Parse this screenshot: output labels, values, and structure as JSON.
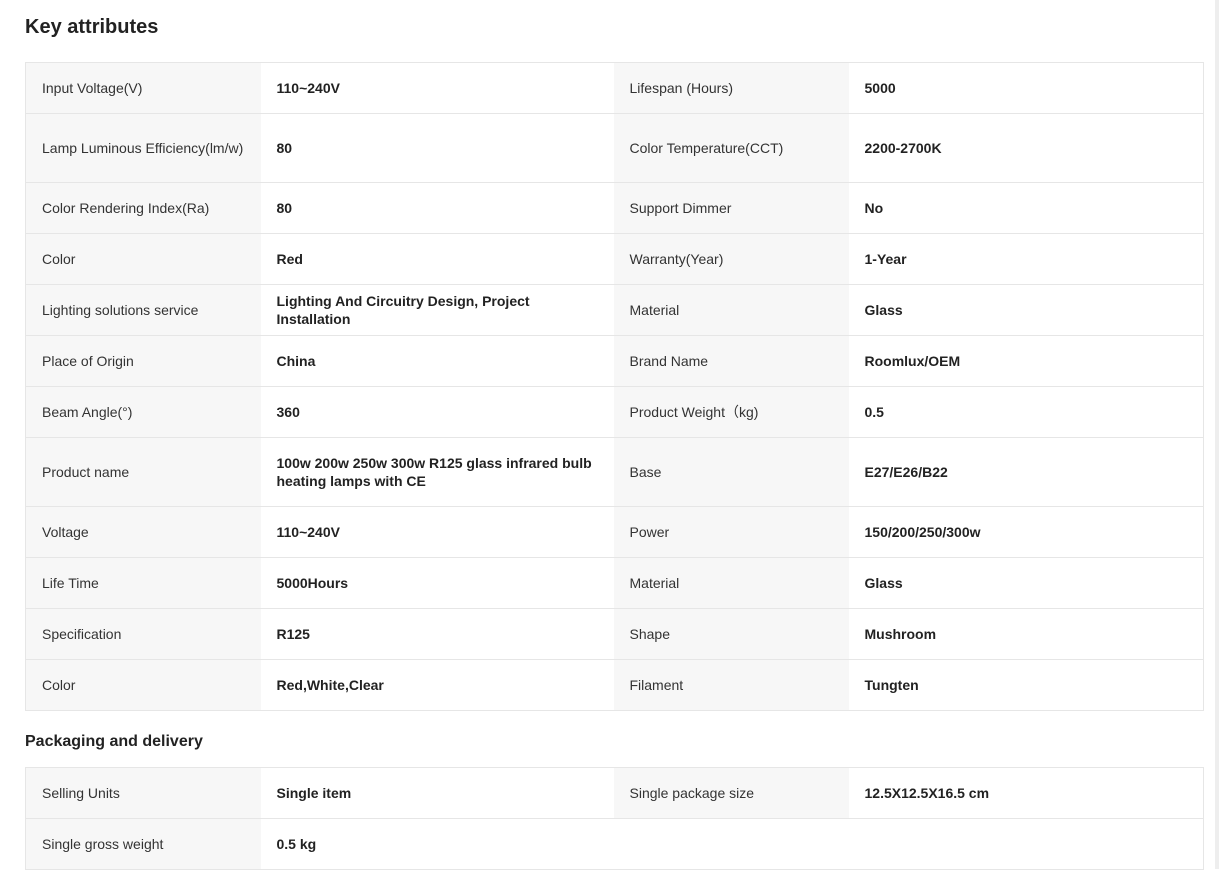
{
  "key_attributes": {
    "title": "Key attributes",
    "rows": [
      {
        "l1": "Input Voltage(V)",
        "v1": "110~240V",
        "l2": "Lifespan (Hours)",
        "v2": "5000"
      },
      {
        "l1": "Lamp Luminous Efficiency(lm/w)",
        "v1": "80",
        "l2": "Color Temperature(CCT)",
        "v2": "2200-2700K"
      },
      {
        "l1": "Color Rendering Index(Ra)",
        "v1": "80",
        "l2": "Support Dimmer",
        "v2": "No"
      },
      {
        "l1": "Color",
        "v1": "Red",
        "l2": "Warranty(Year)",
        "v2": "1-Year"
      },
      {
        "l1": "Lighting solutions service",
        "v1": "Lighting And Circuitry Design, Project Installation",
        "l2": "Material",
        "v2": "Glass"
      },
      {
        "l1": "Place of Origin",
        "v1": "China",
        "l2": "Brand Name",
        "v2": "Roomlux/OEM"
      },
      {
        "l1": "Beam Angle(°)",
        "v1": "360",
        "l2": "Product Weight（kg)",
        "v2": "0.5"
      },
      {
        "l1": "Product name",
        "v1": "100w 200w 250w 300w R125 glass infrared bulb heating lamps with CE",
        "l2": "Base",
        "v2": "E27/E26/B22"
      },
      {
        "l1": "Voltage",
        "v1": "110~240V",
        "l2": "Power",
        "v2": "150/200/250/300w"
      },
      {
        "l1": "Life Time",
        "v1": "5000Hours",
        "l2": "Material",
        "v2": "Glass"
      },
      {
        "l1": "Specification",
        "v1": "R125",
        "l2": "Shape",
        "v2": "Mushroom"
      },
      {
        "l1": "Color",
        "v1": "Red,White,Clear",
        "l2": "Filament",
        "v2": "Tungten"
      }
    ]
  },
  "packaging": {
    "title": "Packaging and delivery",
    "rows": [
      {
        "l1": "Selling Units",
        "v1": "Single item",
        "l2": "Single package size",
        "v2": "12.5X12.5X16.5 cm"
      },
      {
        "l1": "Single gross weight",
        "v1": "0.5 kg",
        "l2": "",
        "v2": ""
      }
    ]
  }
}
